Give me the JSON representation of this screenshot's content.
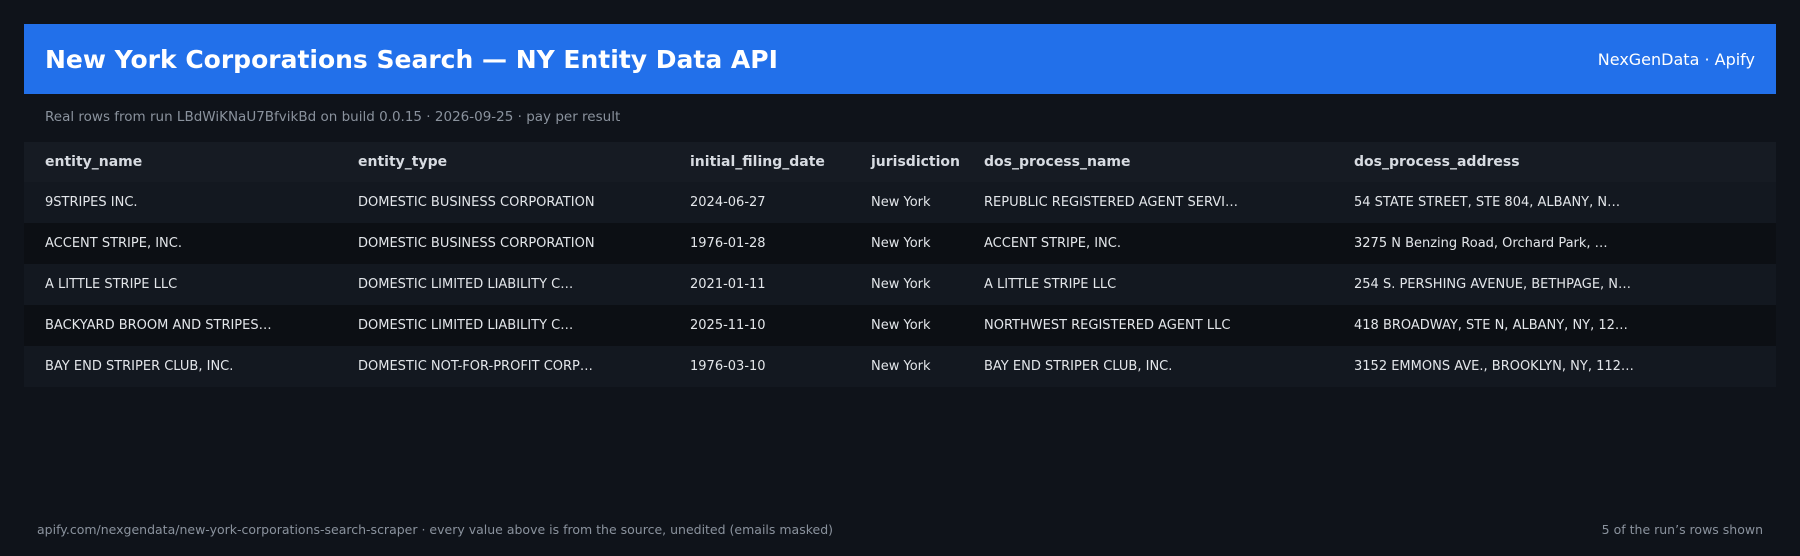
{
  "header": {
    "title": "New York Corporations Search — NY Entity Data API",
    "brand": "NexGenData · Apify"
  },
  "subtitle": "Real rows from run LBdWiKNaU7BfvikBd on build 0.0.15 · 2026-09-25 · pay per result",
  "table": {
    "columns": [
      "entity_name",
      "entity_type",
      "initial_filing_date",
      "jurisdiction",
      "dos_process_name",
      "dos_process_address"
    ],
    "rows": [
      [
        "9STRIPES INC.",
        "DOMESTIC BUSINESS CORPORATION",
        "2024-06-27",
        "New York",
        "REPUBLIC REGISTERED AGENT SERVI…",
        "54 STATE STREET, STE 804, ALBANY, N…"
      ],
      [
        "ACCENT STRIPE, INC.",
        "DOMESTIC BUSINESS CORPORATION",
        "1976-01-28",
        "New York",
        "ACCENT STRIPE, INC.",
        "3275 N Benzing Road, Orchard Park, …"
      ],
      [
        "A LITTLE STRIPE LLC",
        "DOMESTIC LIMITED LIABILITY C…",
        "2021-01-11",
        "New York",
        "A LITTLE STRIPE LLC",
        "254 S. PERSHING AVENUE, BETHPAGE, N…"
      ],
      [
        "BACKYARD BROOM AND STRIPES…",
        "DOMESTIC LIMITED LIABILITY C…",
        "2025-11-10",
        "New York",
        "NORTHWEST REGISTERED AGENT LLC",
        "418 BROADWAY, STE N, ALBANY, NY, 12…"
      ],
      [
        "BAY END STRIPER CLUB, INC.",
        "DOMESTIC NOT-FOR-PROFIT CORP…",
        "1976-03-10",
        "New York",
        "BAY END STRIPER CLUB, INC.",
        "3152 EMMONS AVE., BROOKLYN, NY, 112…"
      ]
    ]
  },
  "footer": {
    "source": "apify.com/nexgendata/new-york-corporations-search-scraper  ·  every value above is from the source, unedited (emails masked)",
    "count": "5 of the run’s rows shown"
  },
  "colors": {
    "accent": "#2270ea",
    "background": "#0f131a"
  }
}
